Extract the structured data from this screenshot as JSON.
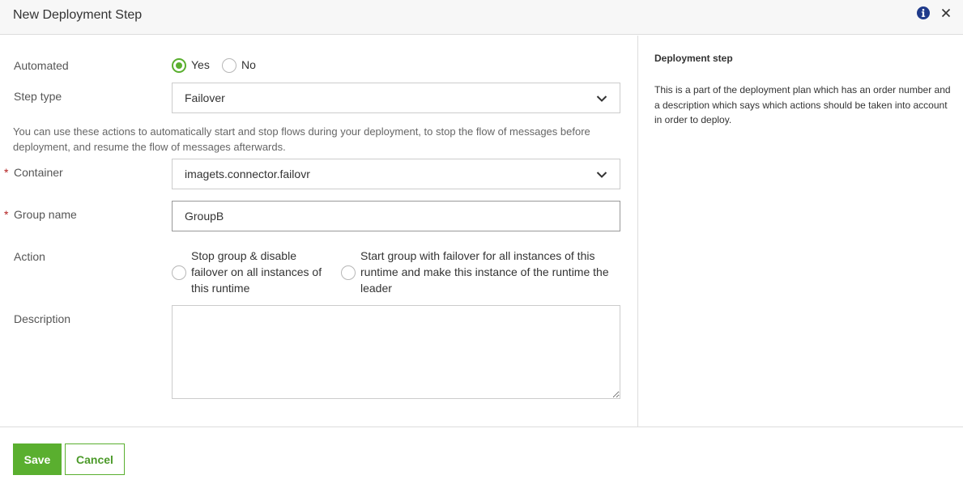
{
  "dialog": {
    "title": "New Deployment Step",
    "info_icon": "info-circle-icon",
    "close_icon": "close-icon"
  },
  "form": {
    "automated": {
      "label": "Automated",
      "options": [
        {
          "label": "Yes",
          "selected": true
        },
        {
          "label": "No",
          "selected": false
        }
      ]
    },
    "step_type": {
      "label": "Step type",
      "value": "Failover"
    },
    "help_text": "You can use these actions to automatically start and stop flows during your deployment, to stop the flow of messages before deployment, and resume the flow of messages afterwards.",
    "container": {
      "required_marker": "*",
      "label": "Container",
      "value": "imagets.connector.failovr"
    },
    "group_name": {
      "required_marker": "*",
      "label": "Group name",
      "value": "GroupB"
    },
    "action": {
      "label": "Action",
      "options": [
        {
          "label": "Stop group & disable failover on all instances of this runtime",
          "selected": false
        },
        {
          "label": "Start group with failover for all instances of this runtime and make this instance of the runtime the leader",
          "selected": false
        }
      ]
    },
    "description": {
      "label": "Description",
      "value": ""
    }
  },
  "side_panel": {
    "title": "Deployment step",
    "text": "This is a part of the deployment plan which has an order number and a description which says which actions should be taken into account in order to deploy."
  },
  "footer": {
    "save_label": "Save",
    "cancel_label": "Cancel"
  },
  "colors": {
    "accent": "#5aaf2f",
    "required": "#b21f1f",
    "info_icon": "#1f3a8a"
  }
}
